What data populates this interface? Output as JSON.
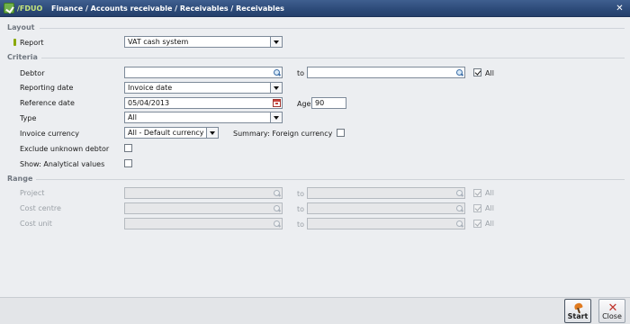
{
  "window": {
    "code": "/FDUO",
    "title": "Finance / Accounts receivable / Receivables / Receivables"
  },
  "layout": {
    "header": "Layout",
    "report_label": "Report",
    "report_value": "VAT cash system"
  },
  "criteria": {
    "header": "Criteria",
    "debtor_label": "Debtor",
    "to_label": "to",
    "debtor_from": "",
    "debtor_to": "",
    "all_label": "All",
    "all_checked": true,
    "reporting_date_label": "Reporting date",
    "reporting_date_value": "Invoice date",
    "reference_date_label": "Reference date",
    "reference_date_value": "05/04/2013",
    "age_label": "Age",
    "age_value": "90",
    "type_label": "Type",
    "type_value": "All",
    "invoice_currency_label": "Invoice currency",
    "invoice_currency_value": "All - Default currency",
    "summary_label": "Summary: Foreign currency",
    "exclude_label": "Exclude unknown debtor",
    "show_analytical_label": "Show: Analytical values"
  },
  "range": {
    "header": "Range",
    "to_label": "to",
    "all_label": "All",
    "rows": [
      {
        "label": "Project"
      },
      {
        "label": "Cost centre"
      },
      {
        "label": "Cost unit"
      }
    ]
  },
  "buttons": {
    "start_label": "Start",
    "close_label": "Close"
  },
  "icons": {
    "app": "app-check-icon",
    "close": "close-icon",
    "lookup": "search-icon",
    "calendar": "calendar-icon",
    "start": "start-icon"
  }
}
